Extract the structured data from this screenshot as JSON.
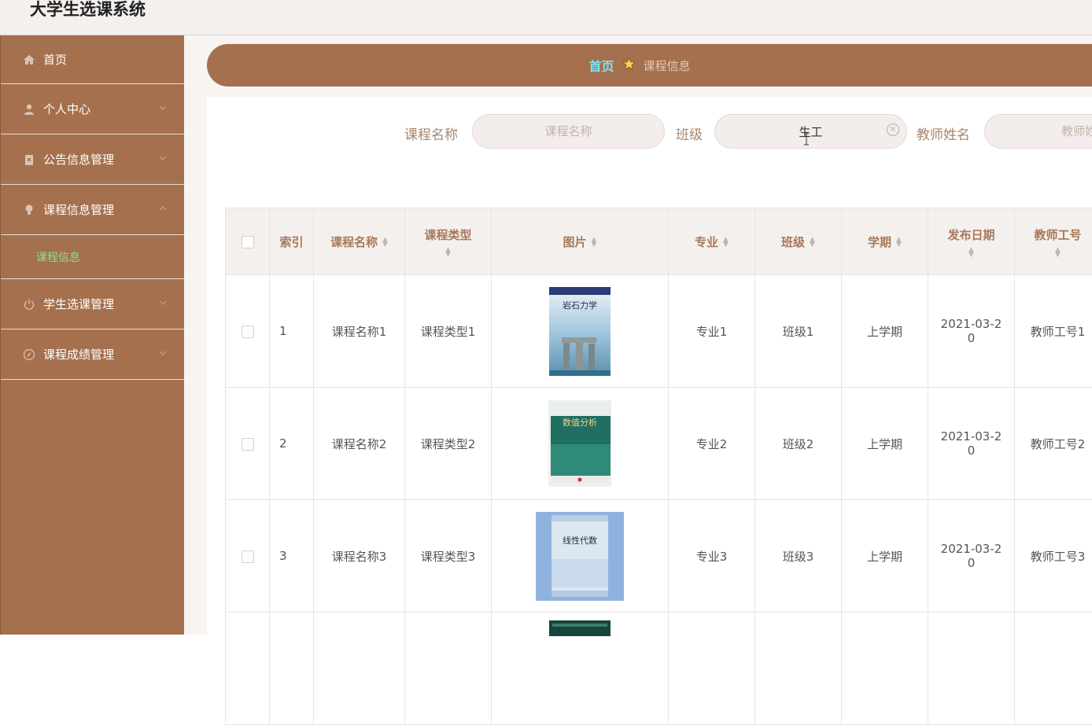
{
  "app": {
    "title": "大学生选课系统"
  },
  "sidebar": {
    "items": [
      {
        "label": "首页",
        "icon": "home-icon"
      },
      {
        "label": "个人中心",
        "icon": "user-icon"
      },
      {
        "label": "公告信息管理",
        "icon": "notice-icon"
      },
      {
        "label": "课程信息管理",
        "icon": "bulb-icon"
      },
      {
        "label": "学生选课管理",
        "icon": "power-icon"
      },
      {
        "label": "课程成绩管理",
        "icon": "compass-icon"
      }
    ],
    "sub_item": "课程信息"
  },
  "breadcrumb": {
    "home": "首页",
    "current": "课程信息"
  },
  "search": {
    "course_label": "课程名称",
    "course_placeholder": "课程名称",
    "course_value": "",
    "class_label": "班级",
    "class_value": "生工",
    "teacher_label": "教师姓名",
    "teacher_placeholder": "教师姓名"
  },
  "table": {
    "headers": [
      "索引",
      "课程名称",
      "课程类型",
      "图片",
      "专业",
      "班级",
      "学期",
      "发布日期",
      "教师工号"
    ],
    "rows": [
      {
        "index": "1",
        "name": "课程名称1",
        "type": "课程类型1",
        "image_title": "岩石力学",
        "major": "专业1",
        "class": "班级1",
        "term": "上学期",
        "date_a": "2021-03-2",
        "date_b": "0",
        "teacher_id": "教师工号1"
      },
      {
        "index": "2",
        "name": "课程名称2",
        "type": "课程类型2",
        "image_title": "数值分析",
        "major": "专业2",
        "class": "班级2",
        "term": "上学期",
        "date_a": "2021-03-2",
        "date_b": "0",
        "teacher_id": "教师工号2"
      },
      {
        "index": "3",
        "name": "课程名称3",
        "type": "课程类型3",
        "image_title": "线性代数",
        "major": "专业3",
        "class": "班级3",
        "term": "上学期",
        "date_a": "2021-03-2",
        "date_b": "0",
        "teacher_id": "教师工号3"
      }
    ]
  },
  "colors": {
    "brand": "#a5704e",
    "breadcrumb_home": "#7fe3f2",
    "active_sub": "#8ee08a",
    "header_text": "#a8785a"
  }
}
